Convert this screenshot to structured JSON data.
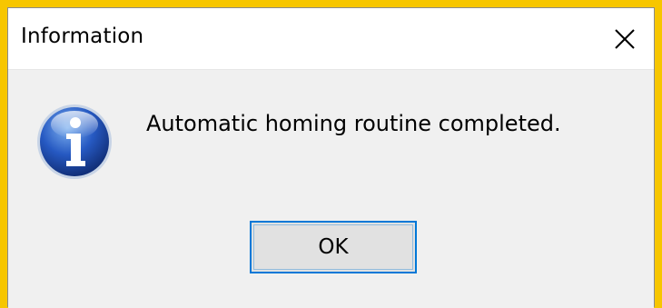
{
  "dialog": {
    "title": "Information",
    "message": "Automatic homing routine completed.",
    "ok_label": "OK",
    "icon": "information-icon",
    "close_icon": "close-icon"
  },
  "colors": {
    "background_border": "#F7C600",
    "dialog_body": "#F0F0F0",
    "titlebar": "#FFFFFF",
    "button_focus": "#0078D7",
    "button_face": "#E1E1E1"
  }
}
